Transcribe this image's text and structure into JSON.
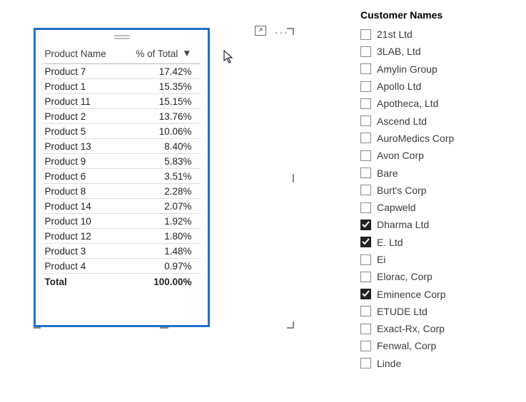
{
  "chart_data": {
    "type": "table",
    "columns": [
      "Product Name",
      "% of Total"
    ],
    "rows": [
      [
        "Product 7",
        17.42
      ],
      [
        "Product 1",
        15.35
      ],
      [
        "Product 11",
        15.15
      ],
      [
        "Product 2",
        13.76
      ],
      [
        "Product 5",
        10.06
      ],
      [
        "Product 13",
        8.4
      ],
      [
        "Product 9",
        5.83
      ],
      [
        "Product 6",
        3.51
      ],
      [
        "Product 8",
        2.28
      ],
      [
        "Product 14",
        2.07
      ],
      [
        "Product 10",
        1.92
      ],
      [
        "Product 12",
        1.8
      ],
      [
        "Product 3",
        1.48
      ],
      [
        "Product 4",
        0.97
      ]
    ],
    "total_label": "Total",
    "total_value": 100.0,
    "sort": {
      "column": "% of Total",
      "direction": "desc"
    }
  },
  "table": {
    "col_product": "Product Name",
    "col_pct": "% of Total",
    "rows": {
      "0": {
        "name": "Product 7",
        "pct": "17.42%"
      },
      "1": {
        "name": "Product 1",
        "pct": "15.35%"
      },
      "2": {
        "name": "Product 11",
        "pct": "15.15%"
      },
      "3": {
        "name": "Product 2",
        "pct": "13.76%"
      },
      "4": {
        "name": "Product 5",
        "pct": "10.06%"
      },
      "5": {
        "name": "Product 13",
        "pct": "8.40%"
      },
      "6": {
        "name": "Product 9",
        "pct": "5.83%"
      },
      "7": {
        "name": "Product 6",
        "pct": "3.51%"
      },
      "8": {
        "name": "Product 8",
        "pct": "2.28%"
      },
      "9": {
        "name": "Product 14",
        "pct": "2.07%"
      },
      "10": {
        "name": "Product 10",
        "pct": "1.92%"
      },
      "11": {
        "name": "Product 12",
        "pct": "1.80%"
      },
      "12": {
        "name": "Product 3",
        "pct": "1.48%"
      },
      "13": {
        "name": "Product 4",
        "pct": "0.97%"
      }
    },
    "total_label": "Total",
    "total_pct": "100.00%"
  },
  "header_icons": {
    "focus": "focus-mode-icon",
    "more": "more-options-icon"
  },
  "slicer": {
    "title": "Customer Names",
    "items": {
      "0": {
        "label": "21st Ltd",
        "checked": false
      },
      "1": {
        "label": "3LAB, Ltd",
        "checked": false
      },
      "2": {
        "label": "Amylin Group",
        "checked": false
      },
      "3": {
        "label": "Apollo Ltd",
        "checked": false
      },
      "4": {
        "label": "Apotheca, Ltd",
        "checked": false
      },
      "5": {
        "label": "Ascend Ltd",
        "checked": false
      },
      "6": {
        "label": "AuroMedics Corp",
        "checked": false
      },
      "7": {
        "label": "Avon Corp",
        "checked": false
      },
      "8": {
        "label": "Bare",
        "checked": false
      },
      "9": {
        "label": "Burt's Corp",
        "checked": false
      },
      "10": {
        "label": "Capweld",
        "checked": false
      },
      "11": {
        "label": "Dharma Ltd",
        "checked": true
      },
      "12": {
        "label": "E. Ltd",
        "checked": true
      },
      "13": {
        "label": "Ei",
        "checked": false
      },
      "14": {
        "label": "Elorac, Corp",
        "checked": false
      },
      "15": {
        "label": "Eminence Corp",
        "checked": true
      },
      "16": {
        "label": "ETUDE Ltd",
        "checked": false
      },
      "17": {
        "label": "Exact-Rx, Corp",
        "checked": false
      },
      "18": {
        "label": "Fenwal, Corp",
        "checked": false
      },
      "19": {
        "label": "Linde",
        "checked": false
      }
    }
  }
}
